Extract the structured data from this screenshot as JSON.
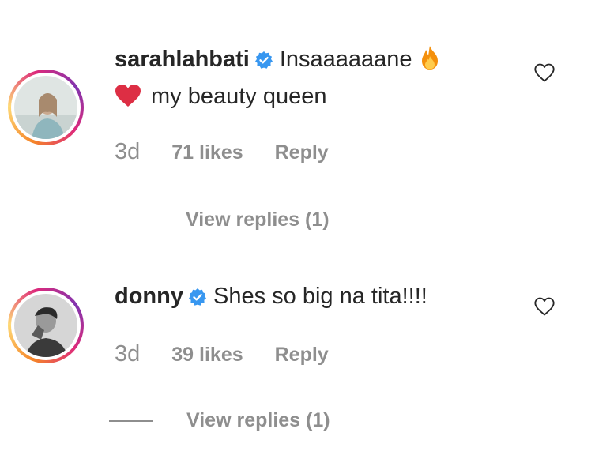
{
  "comments": [
    {
      "username": "sarahlahbati",
      "verified": true,
      "text_line1": "Insaaaaaane",
      "text_line2": "my beauty queen",
      "time": "3d",
      "likes": "71 likes",
      "reply_label": "Reply",
      "view_replies": "View replies (1)"
    },
    {
      "username": "donny",
      "verified": true,
      "text_line1": "Shes so big na tita!!!!",
      "time": "3d",
      "likes": "39 likes",
      "reply_label": "Reply",
      "view_replies": "View replies (1)"
    }
  ],
  "colors": {
    "text": "#262626",
    "meta": "#8e8e8e",
    "verified": "#3897f0"
  }
}
